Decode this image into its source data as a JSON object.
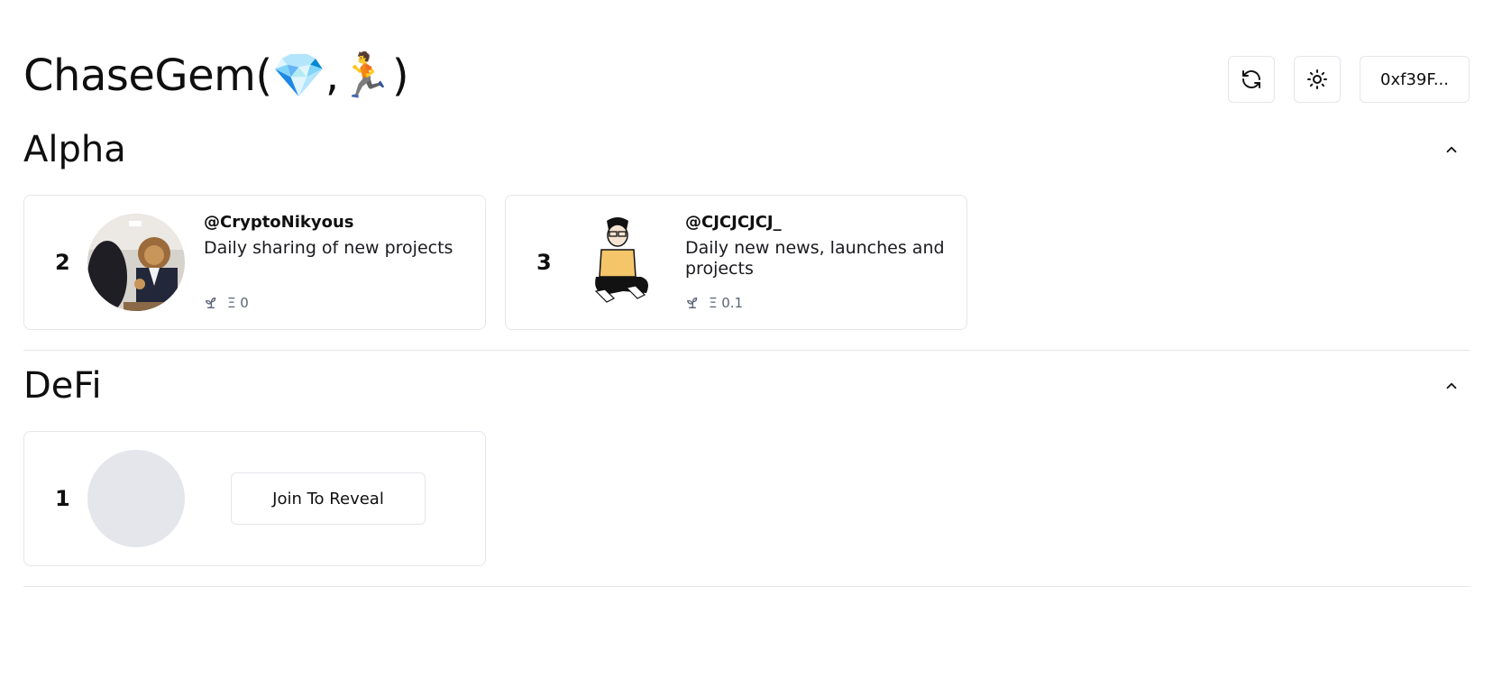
{
  "app": {
    "title": "ChaseGem(💎,🏃)",
    "title_icons": [
      "gem-icon",
      "runner-icon"
    ]
  },
  "header": {
    "refresh_icon": "refresh-icon",
    "theme_icon": "sun-icon",
    "wallet_label": "0xf39F..."
  },
  "sections": [
    {
      "title": "Alpha",
      "toggle_icon": "chevron-up-icon",
      "cards": [
        {
          "rank": "2",
          "handle": "@CryptoNikyous",
          "description": "Daily sharing of new projects",
          "stat_icon": "sprout-icon",
          "stat_value": "Ξ 0"
        },
        {
          "rank": "3",
          "handle": "@CJCJCJCJ_",
          "description": "Daily new news, launches and projects",
          "stat_icon": "sprout-icon",
          "stat_value": "Ξ 0.1"
        }
      ]
    },
    {
      "title": "DeFi",
      "toggle_icon": "chevron-up-icon",
      "cards": [
        {
          "rank": "1",
          "locked": true,
          "join_label": "Join To Reveal"
        }
      ]
    }
  ],
  "colors": {
    "border": "#e4e6eb",
    "text": "#0f0f10",
    "muted": "#5b6478",
    "placeholder": "#e4e6eb"
  }
}
